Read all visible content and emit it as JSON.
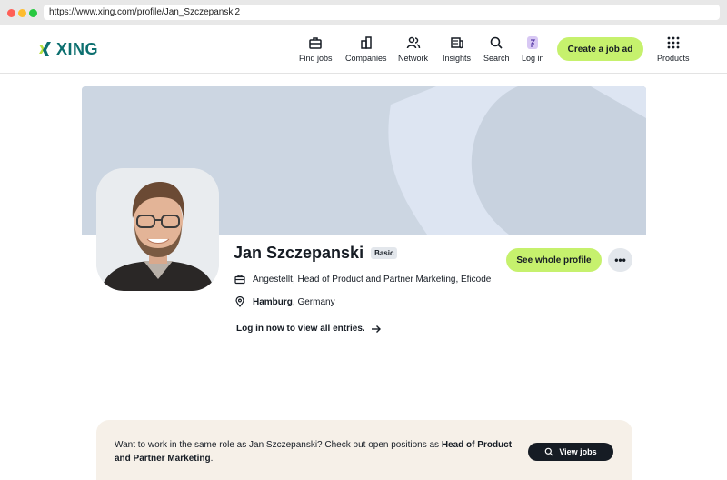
{
  "browser": {
    "url": "https://www.xing.com/profile/Jan_Szczepanski2"
  },
  "header": {
    "logo_text": "XING",
    "nav": {
      "find_jobs": "Find jobs",
      "companies": "Companies",
      "network": "Network",
      "insights": "Insights",
      "search": "Search",
      "login": "Log in",
      "products": "Products"
    },
    "cta": "Create a job ad"
  },
  "profile": {
    "name": "Jan Szczepanski",
    "badge": "Basic",
    "job": "Angestellt, Head of Product and Partner Marketing, Eficode",
    "city": "Hamburg",
    "country": ", Germany",
    "login_prompt": "Log in now to view all entries.",
    "see_profile": "See whole profile",
    "more": "•••"
  },
  "promo": {
    "text_start": "Want to work in the same role as Jan Szczepanski? Check out open positions as ",
    "role": "Head of Product and Partner Marketing",
    "text_end": ".",
    "button": "View jobs"
  },
  "colors": {
    "accent": "#c6f16d",
    "brand": "#0c6f6f",
    "cover": "#ccd6e2",
    "promo_bg": "#f6f0e8"
  }
}
